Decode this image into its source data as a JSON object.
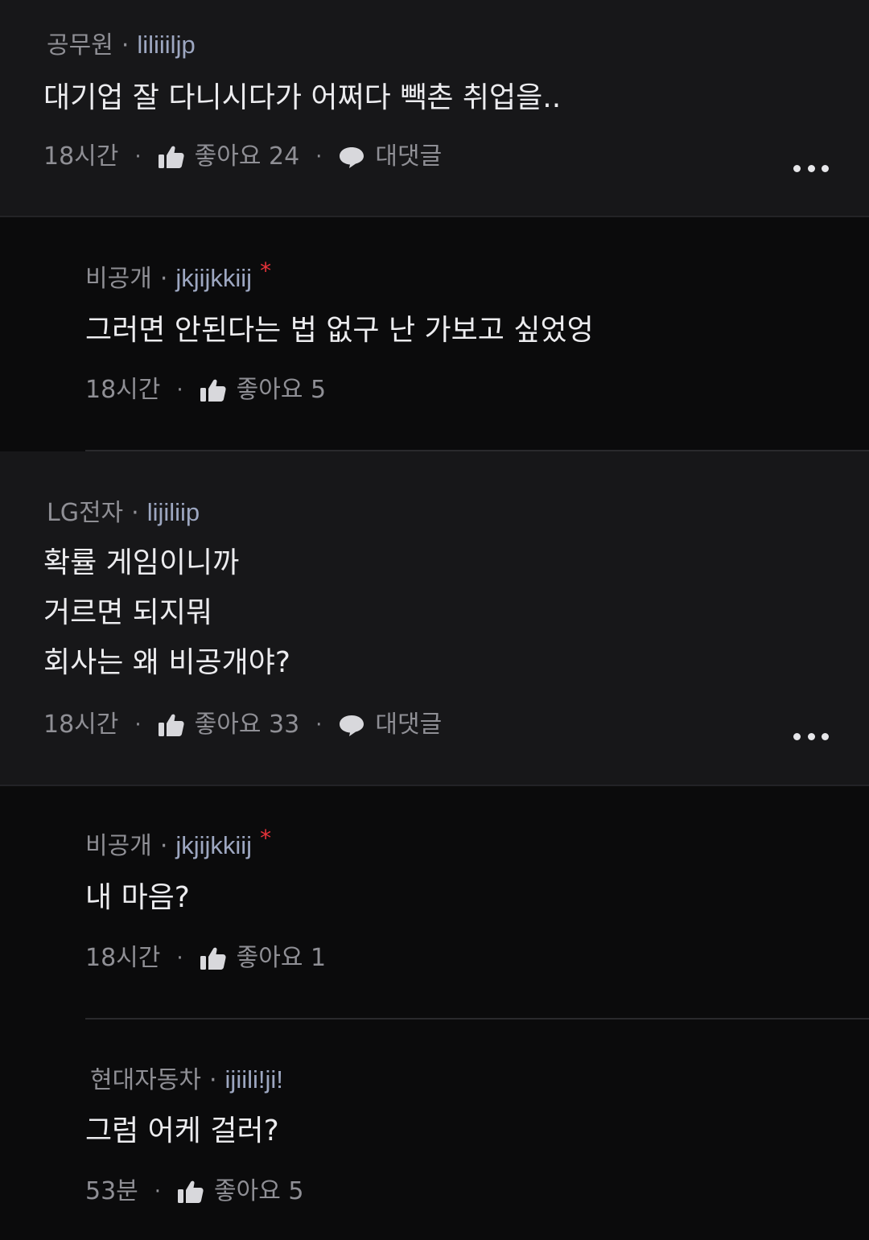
{
  "colors": {
    "top_bg": "#171719",
    "reply_bg": "#0b0b0c",
    "text": "#ececef",
    "meta": "#8f8f95",
    "username": "#9da7c1",
    "badge": "#e8333a"
  },
  "separator": "·",
  "comments": [
    {
      "company": "공무원",
      "user": "liliiiljp",
      "text": [
        "대기업 잘 다니시다가 어쩌다 빽촌 취업을.."
      ],
      "time": "18시간",
      "likes": "좋아요 24",
      "reply_label": "대댓글"
    },
    {
      "company": "비공개",
      "user": "jkjijkkiij",
      "badge": "*",
      "text": [
        "그러면 안된다는 법 없구 난 가보고 싶었엉"
      ],
      "time": "18시간",
      "likes": "좋아요 5"
    },
    {
      "company": "LG전자",
      "user": "lijiliip",
      "text": [
        "확률 게임이니까",
        "거르면 되지뭐",
        "회사는 왜 비공개야?"
      ],
      "time": "18시간",
      "likes": "좋아요 33",
      "reply_label": "대댓글"
    },
    {
      "company": "비공개",
      "user": "jkjijkkiij",
      "badge": "*",
      "text": [
        "내 마음?"
      ],
      "time": "18시간",
      "likes": "좋아요 1"
    },
    {
      "company": "현대자동차",
      "user": "ijiili!ji!",
      "text": [
        "그럼 어케 걸러?"
      ],
      "time": "53분",
      "likes": "좋아요 5"
    }
  ],
  "icons": {
    "like": "thumbs-up-icon",
    "reply": "speech-bubble-icon",
    "more": "more-dots-icon"
  }
}
